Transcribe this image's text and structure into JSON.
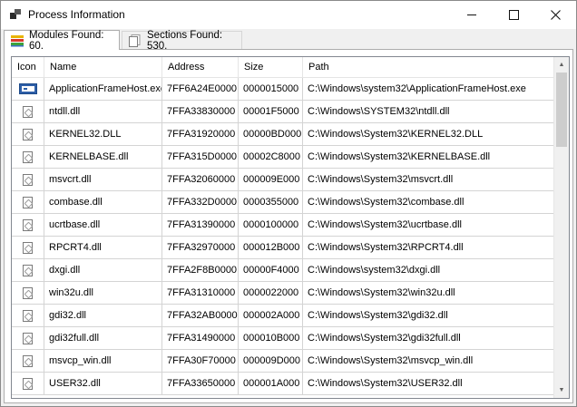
{
  "window": {
    "title": "Process Information",
    "title_icon": "app-window-icon",
    "controls": {
      "minimize": "minimize-icon",
      "maximize": "maximize-icon",
      "close": "close-icon"
    }
  },
  "tabs": [
    {
      "label": "Modules Found: 60.",
      "icon": "modules-stack-icon",
      "active": true
    },
    {
      "label": "Sections Found: 530.",
      "icon": "sections-pages-icon",
      "active": false
    }
  ],
  "table": {
    "columns": [
      "Icon",
      "Name",
      "Address",
      "Size",
      "Path"
    ],
    "rows": [
      {
        "icon": "exe-window-icon",
        "name": "ApplicationFrameHost.exe",
        "address": "7FF6A24E0000",
        "size": "0000015000",
        "path": "C:\\Windows\\system32\\ApplicationFrameHost.exe"
      },
      {
        "icon": "dll-file-icon",
        "name": "ntdll.dll",
        "address": "7FFA33830000",
        "size": "00001F5000",
        "path": "C:\\Windows\\SYSTEM32\\ntdll.dll"
      },
      {
        "icon": "dll-file-icon",
        "name": "KERNEL32.DLL",
        "address": "7FFA31920000",
        "size": "00000BD000",
        "path": "C:\\Windows\\System32\\KERNEL32.DLL"
      },
      {
        "icon": "dll-file-icon",
        "name": "KERNELBASE.dll",
        "address": "7FFA315D0000",
        "size": "00002C8000",
        "path": "C:\\Windows\\System32\\KERNELBASE.dll"
      },
      {
        "icon": "dll-file-icon",
        "name": "msvcrt.dll",
        "address": "7FFA32060000",
        "size": "000009E000",
        "path": "C:\\Windows\\System32\\msvcrt.dll"
      },
      {
        "icon": "dll-file-icon",
        "name": "combase.dll",
        "address": "7FFA332D0000",
        "size": "0000355000",
        "path": "C:\\Windows\\System32\\combase.dll"
      },
      {
        "icon": "dll-file-icon",
        "name": "ucrtbase.dll",
        "address": "7FFA31390000",
        "size": "0000100000",
        "path": "C:\\Windows\\System32\\ucrtbase.dll"
      },
      {
        "icon": "dll-file-icon",
        "name": "RPCRT4.dll",
        "address": "7FFA32970000",
        "size": "000012B000",
        "path": "C:\\Windows\\System32\\RPCRT4.dll"
      },
      {
        "icon": "dll-file-icon",
        "name": "dxgi.dll",
        "address": "7FFA2F8B0000",
        "size": "00000F4000",
        "path": "C:\\Windows\\system32\\dxgi.dll"
      },
      {
        "icon": "dll-file-icon",
        "name": "win32u.dll",
        "address": "7FFA31310000",
        "size": "0000022000",
        "path": "C:\\Windows\\System32\\win32u.dll"
      },
      {
        "icon": "dll-file-icon",
        "name": "gdi32.dll",
        "address": "7FFA32AB0000",
        "size": "000002A000",
        "path": "C:\\Windows\\System32\\gdi32.dll"
      },
      {
        "icon": "dll-file-icon",
        "name": "gdi32full.dll",
        "address": "7FFA31490000",
        "size": "000010B000",
        "path": "C:\\Windows\\System32\\gdi32full.dll"
      },
      {
        "icon": "dll-file-icon",
        "name": "msvcp_win.dll",
        "address": "7FFA30F70000",
        "size": "000009D000",
        "path": "C:\\Windows\\System32\\msvcp_win.dll"
      },
      {
        "icon": "dll-file-icon",
        "name": "USER32.dll",
        "address": "7FFA33650000",
        "size": "000001A000",
        "path": "C:\\Windows\\System32\\USER32.dll"
      }
    ]
  },
  "colors": {
    "exe_icon": "#2e5fa8",
    "grid_line": "#d4d4d4",
    "window_bg": "#f0f0f0"
  }
}
